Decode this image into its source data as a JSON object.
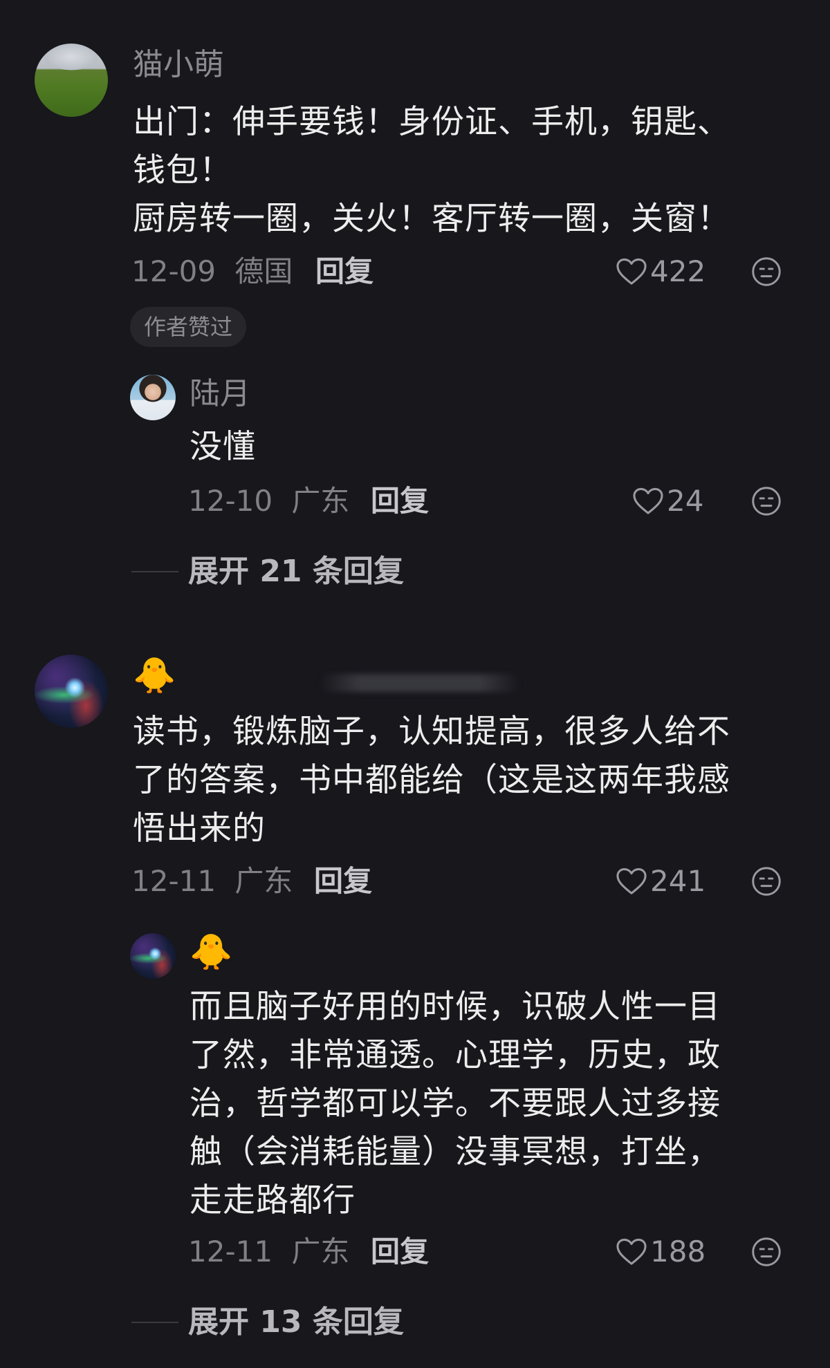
{
  "comments": [
    {
      "username": "猫小萌",
      "content_lines": [
        "出门：伸手要钱！身份证、手机，钥匙、",
        "钱包！",
        "厨房转一圈，关火！客厅转一圈，关窗！"
      ],
      "date": "12-09",
      "location": "德国",
      "reply_label": "回复",
      "likes": "422",
      "badge": "作者赞过",
      "replies": [
        {
          "username": "陆月",
          "content_lines": [
            "没懂"
          ],
          "date": "12-10",
          "location": "广东",
          "reply_label": "回复",
          "likes": "24"
        }
      ],
      "expand_label": "展开 21 条回复"
    },
    {
      "username_emoji": "🐥",
      "content_lines": [
        "读书，锻炼脑子，认知提高，很多人给不",
        "了的答案，书中都能给（这是这两年我感",
        "悟出来的"
      ],
      "date": "12-11",
      "location": "广东",
      "reply_label": "回复",
      "likes": "241",
      "replies": [
        {
          "username_emoji": "🐥",
          "content_lines": [
            "而且脑子好用的时候，识破人性一目",
            "了然，非常通透。心理学，历史，政",
            "治，哲学都可以学。不要跟人过多接",
            "触（会消耗能量）没事冥想，打坐，",
            "走走路都行"
          ],
          "date": "12-11",
          "location": "广东",
          "reply_label": "回复",
          "likes": "188"
        }
      ],
      "expand_label": "展开 13 条回复"
    }
  ],
  "icons": {
    "like": "heart-outline-icon",
    "dislike": "neutral-face-icon"
  }
}
